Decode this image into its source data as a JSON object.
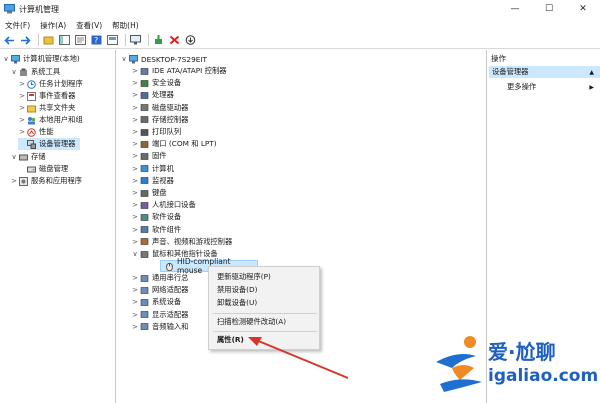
{
  "window": {
    "title": "计算机管理",
    "minimize": "—",
    "maximize": "☐",
    "close": "✕"
  },
  "menu": [
    "文件(F)",
    "操作(A)",
    "查看(V)",
    "帮助(H)"
  ],
  "left_tree": [
    {
      "label": "计算机管理(本地)",
      "level": 0,
      "arrow": "∨",
      "icon": "computer-icon"
    },
    {
      "label": "系统工具",
      "level": 1,
      "arrow": "∨",
      "icon": "tools-icon"
    },
    {
      "label": "任务计划程序",
      "level": 2,
      "arrow": ">",
      "icon": "clock-icon"
    },
    {
      "label": "事件查看器",
      "level": 2,
      "arrow": ">",
      "icon": "event-icon"
    },
    {
      "label": "共享文件夹",
      "level": 2,
      "arrow": ">",
      "icon": "folder-icon"
    },
    {
      "label": "本地用户和组",
      "level": 2,
      "arrow": ">",
      "icon": "users-icon"
    },
    {
      "label": "性能",
      "level": 2,
      "arrow": ">",
      "icon": "performance-icon"
    },
    {
      "label": "设备管理器",
      "level": 2,
      "arrow": "",
      "icon": "device-manager-icon",
      "selected": true
    },
    {
      "label": "存储",
      "level": 1,
      "arrow": "∨",
      "icon": "storage-icon"
    },
    {
      "label": "磁盘管理",
      "level": 2,
      "arrow": "",
      "icon": "disk-icon"
    },
    {
      "label": "服务和应用程序",
      "level": 1,
      "arrow": ">",
      "icon": "services-icon"
    }
  ],
  "device_tree": {
    "root": "DESKTOP-7S29EIT",
    "items": [
      "IDE ATA/ATAPI 控制器",
      "安全设备",
      "处理器",
      "磁盘驱动器",
      "存储控制器",
      "打印队列",
      "端口 (COM 和 LPT)",
      "固件",
      "计算机",
      "监视器",
      "键盘",
      "人机接口设备",
      "软件设备",
      "软件组件",
      "声音、视频和游戏控制器",
      "鼠标和其他指针设备"
    ],
    "selected_child": "HID-compliant mouse",
    "after": [
      "通用串行总",
      "网络适配器",
      "系统设备",
      "显示适配器",
      "音频输入和"
    ]
  },
  "context_menu": {
    "items": [
      "更新驱动程序(P)",
      "禁用设备(D)",
      "卸载设备(U)",
      "扫描检测硬件改动(A)",
      "属性(R)"
    ]
  },
  "actions": {
    "header": "操作",
    "selected": "设备管理器",
    "more": "更多操作"
  },
  "watermark": {
    "brand": "爱·尬聊",
    "domain": "igaliao.com"
  },
  "colors": {
    "selection": "#cce8ff",
    "accent": "#1e6fd9",
    "arrow": "#d8352a"
  }
}
